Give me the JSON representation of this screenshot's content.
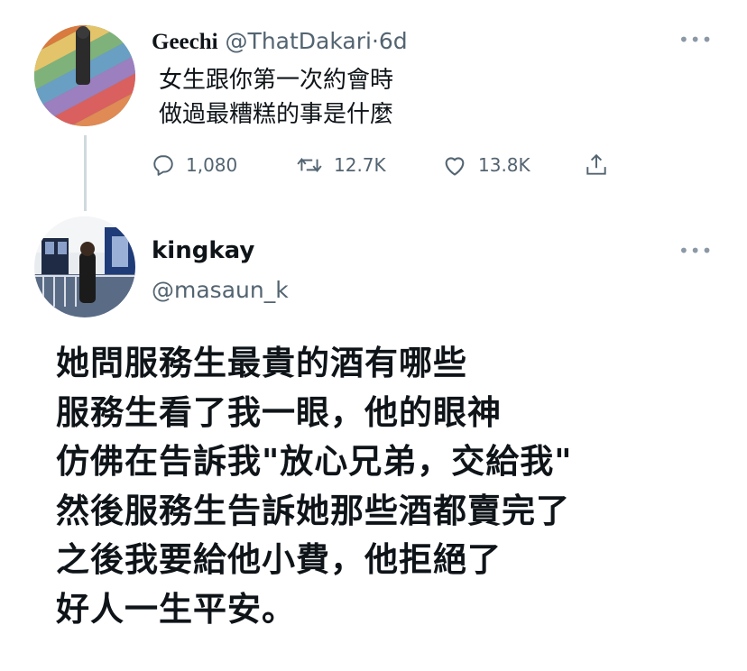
{
  "original_tweet": {
    "author_name": "Geechi",
    "handle": "@ThatDakari",
    "separator": "·",
    "time": "6d",
    "text_lines": [
      "女生跟你第一次約會時",
      "做過最糟糕的事是什麼"
    ],
    "more_icon": "more-horizontal-icon",
    "actions": {
      "reply_count": "1,080",
      "retweet_count": "12.7K",
      "like_count": "13.8K"
    }
  },
  "reply_tweet": {
    "author_name": "kingkay",
    "handle": "@masaun_k",
    "more_icon": "more-horizontal-icon",
    "text_lines": [
      "她問服務生最貴的酒有哪些",
      "服務生看了我一眼，他的眼神",
      "仿佛在告訴我\"放心兄弟，交給我\"",
      "然後服務生告訴她那些酒都賣完了",
      "之後我要給他小費，他拒絕了",
      "好人一生平安。"
    ]
  },
  "colors": {
    "text": "#0f1419",
    "muted": "#536471",
    "thread_line": "#cfd9de"
  }
}
